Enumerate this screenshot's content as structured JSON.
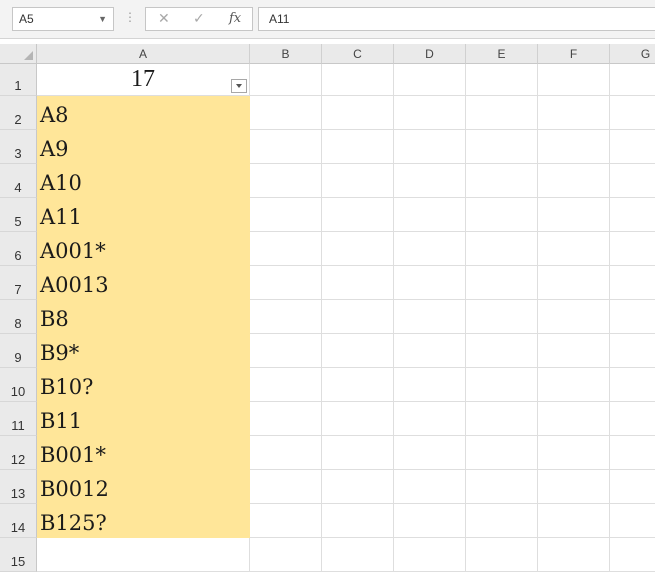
{
  "formula_bar": {
    "name_box": "A5",
    "cancel_icon": "✕",
    "enter_icon": "✓",
    "fx_label": "fx",
    "formula": "A11"
  },
  "columns": [
    "A",
    "B",
    "C",
    "D",
    "E",
    "F",
    "G"
  ],
  "rows": [
    "1",
    "2",
    "3",
    "4",
    "5",
    "6",
    "7",
    "8",
    "9",
    "10",
    "11",
    "12",
    "13",
    "14",
    "15"
  ],
  "header_cell": "17",
  "cells": [
    "A8",
    "A9",
    "A10",
    "A11",
    "A001*",
    "A0013",
    "B8",
    "B9*",
    "B10?",
    "B11",
    "B001*",
    "B0012",
    "B125?"
  ],
  "colors": {
    "fill": "#ffe699"
  }
}
